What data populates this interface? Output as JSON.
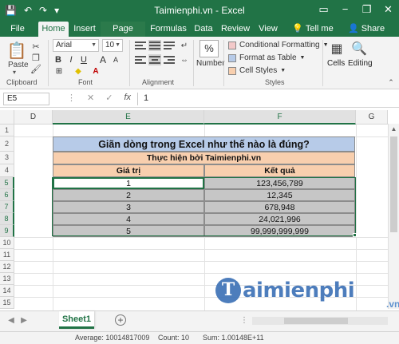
{
  "titlebar": {
    "title": "Taimienphi.vn - Excel",
    "qat": [
      "💾",
      "↶",
      "↷",
      "▾"
    ],
    "controls": [
      "▭",
      "−",
      "❐",
      "✕"
    ]
  },
  "tabs": {
    "file": "File",
    "home": "Home",
    "insert": "Insert",
    "page_layout": "Page Layout",
    "formulas": "Formulas",
    "data": "Data",
    "review": "Review",
    "view": "View",
    "tell_me": "Tell me",
    "share": "Share"
  },
  "ribbon": {
    "clipboard": {
      "paste": "Paste",
      "label": "Clipboard"
    },
    "font": {
      "name": "Arial",
      "size": "10",
      "label": "Font",
      "bold": "B",
      "italic": "I",
      "underline": "U",
      "grow": "A",
      "shrink": "A"
    },
    "alignment": {
      "label": "Alignment"
    },
    "number": {
      "label": "Number",
      "symbol": "%"
    },
    "styles": {
      "label": "Styles",
      "conditional": "Conditional Formatting",
      "table": "Format as Table",
      "cell_styles": "Cell Styles"
    },
    "cells": {
      "label": "Cells"
    },
    "editing": {
      "label": "Editing"
    }
  },
  "formula_bar": {
    "name_box": "E5",
    "value": "1",
    "icons": [
      "⋮",
      "✕",
      "✓",
      "fx"
    ]
  },
  "grid": {
    "columns": [
      "D",
      "E",
      "F",
      "G"
    ],
    "rows": [
      "1",
      "2",
      "3",
      "4",
      "5",
      "6",
      "7",
      "8",
      "9",
      "10",
      "11",
      "12",
      "13",
      "14",
      "15"
    ],
    "title": "Giãn dòng trong Excel như thế nào là đúng?",
    "subtitle": "Thực hiện bởi Taimienphi.vn",
    "header_left": "Giá trị",
    "header_right": "Kết quả",
    "values": [
      "1",
      "2",
      "3",
      "4",
      "5"
    ],
    "results": [
      "123,456,789",
      "12,345",
      "678,948",
      "24,021,996",
      "99,999,999,999"
    ]
  },
  "sheets": {
    "active": "Sheet1",
    "add": "+"
  },
  "status": {
    "average": "Average: 10014817009",
    "count": "Count: 10",
    "sum": "Sum: 1.00148E+11"
  },
  "watermark": {
    "logo_letter": "T",
    "text": "aimienphi",
    "suffix": ".vn"
  },
  "colors": {
    "excel_green": "#217346",
    "title_fill": "#b7cbe8",
    "header_fill": "#f8cfae",
    "data_fill": "#c6c6c6"
  }
}
